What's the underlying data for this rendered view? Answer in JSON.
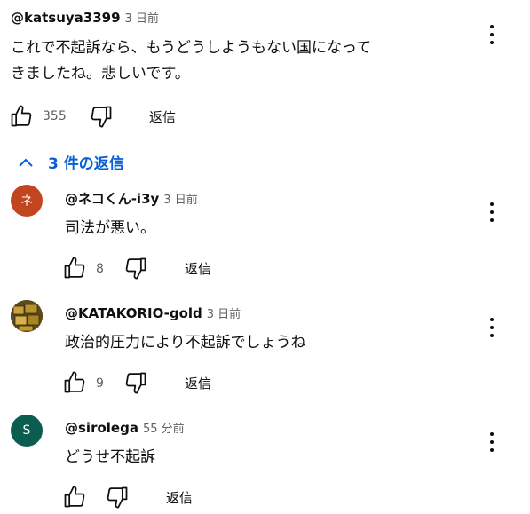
{
  "main_comment": {
    "author": "@katsuya3399",
    "time": "3 日前",
    "lines": [
      "これで不起訴なら、もうどうしようもない国になって",
      "きましたね。悲しいです。"
    ],
    "likes": "355",
    "reply_label": "返信"
  },
  "replies_toggle": {
    "label": "3 件の返信"
  },
  "replies": [
    {
      "author": "@ネコくん-i3y",
      "time": "3 日前",
      "avatar_letter": "ネ",
      "avatar_color": "#c1461f",
      "text": "司法が悪い。",
      "likes": "8",
      "reply_label": "返信"
    },
    {
      "author": "@KATAKORIO-gold",
      "time": "3 日前",
      "avatar_letter": "",
      "avatar_color": "#6b5a23",
      "text": "政治的圧力により不起訴でしょうね",
      "likes": "9",
      "reply_label": "返信"
    },
    {
      "author": "@sirolega",
      "time": "55 分前",
      "avatar_letter": "S",
      "avatar_color": "#0b5e4f",
      "text": "どうせ不起訴",
      "likes": "",
      "reply_label": "返信"
    }
  ]
}
